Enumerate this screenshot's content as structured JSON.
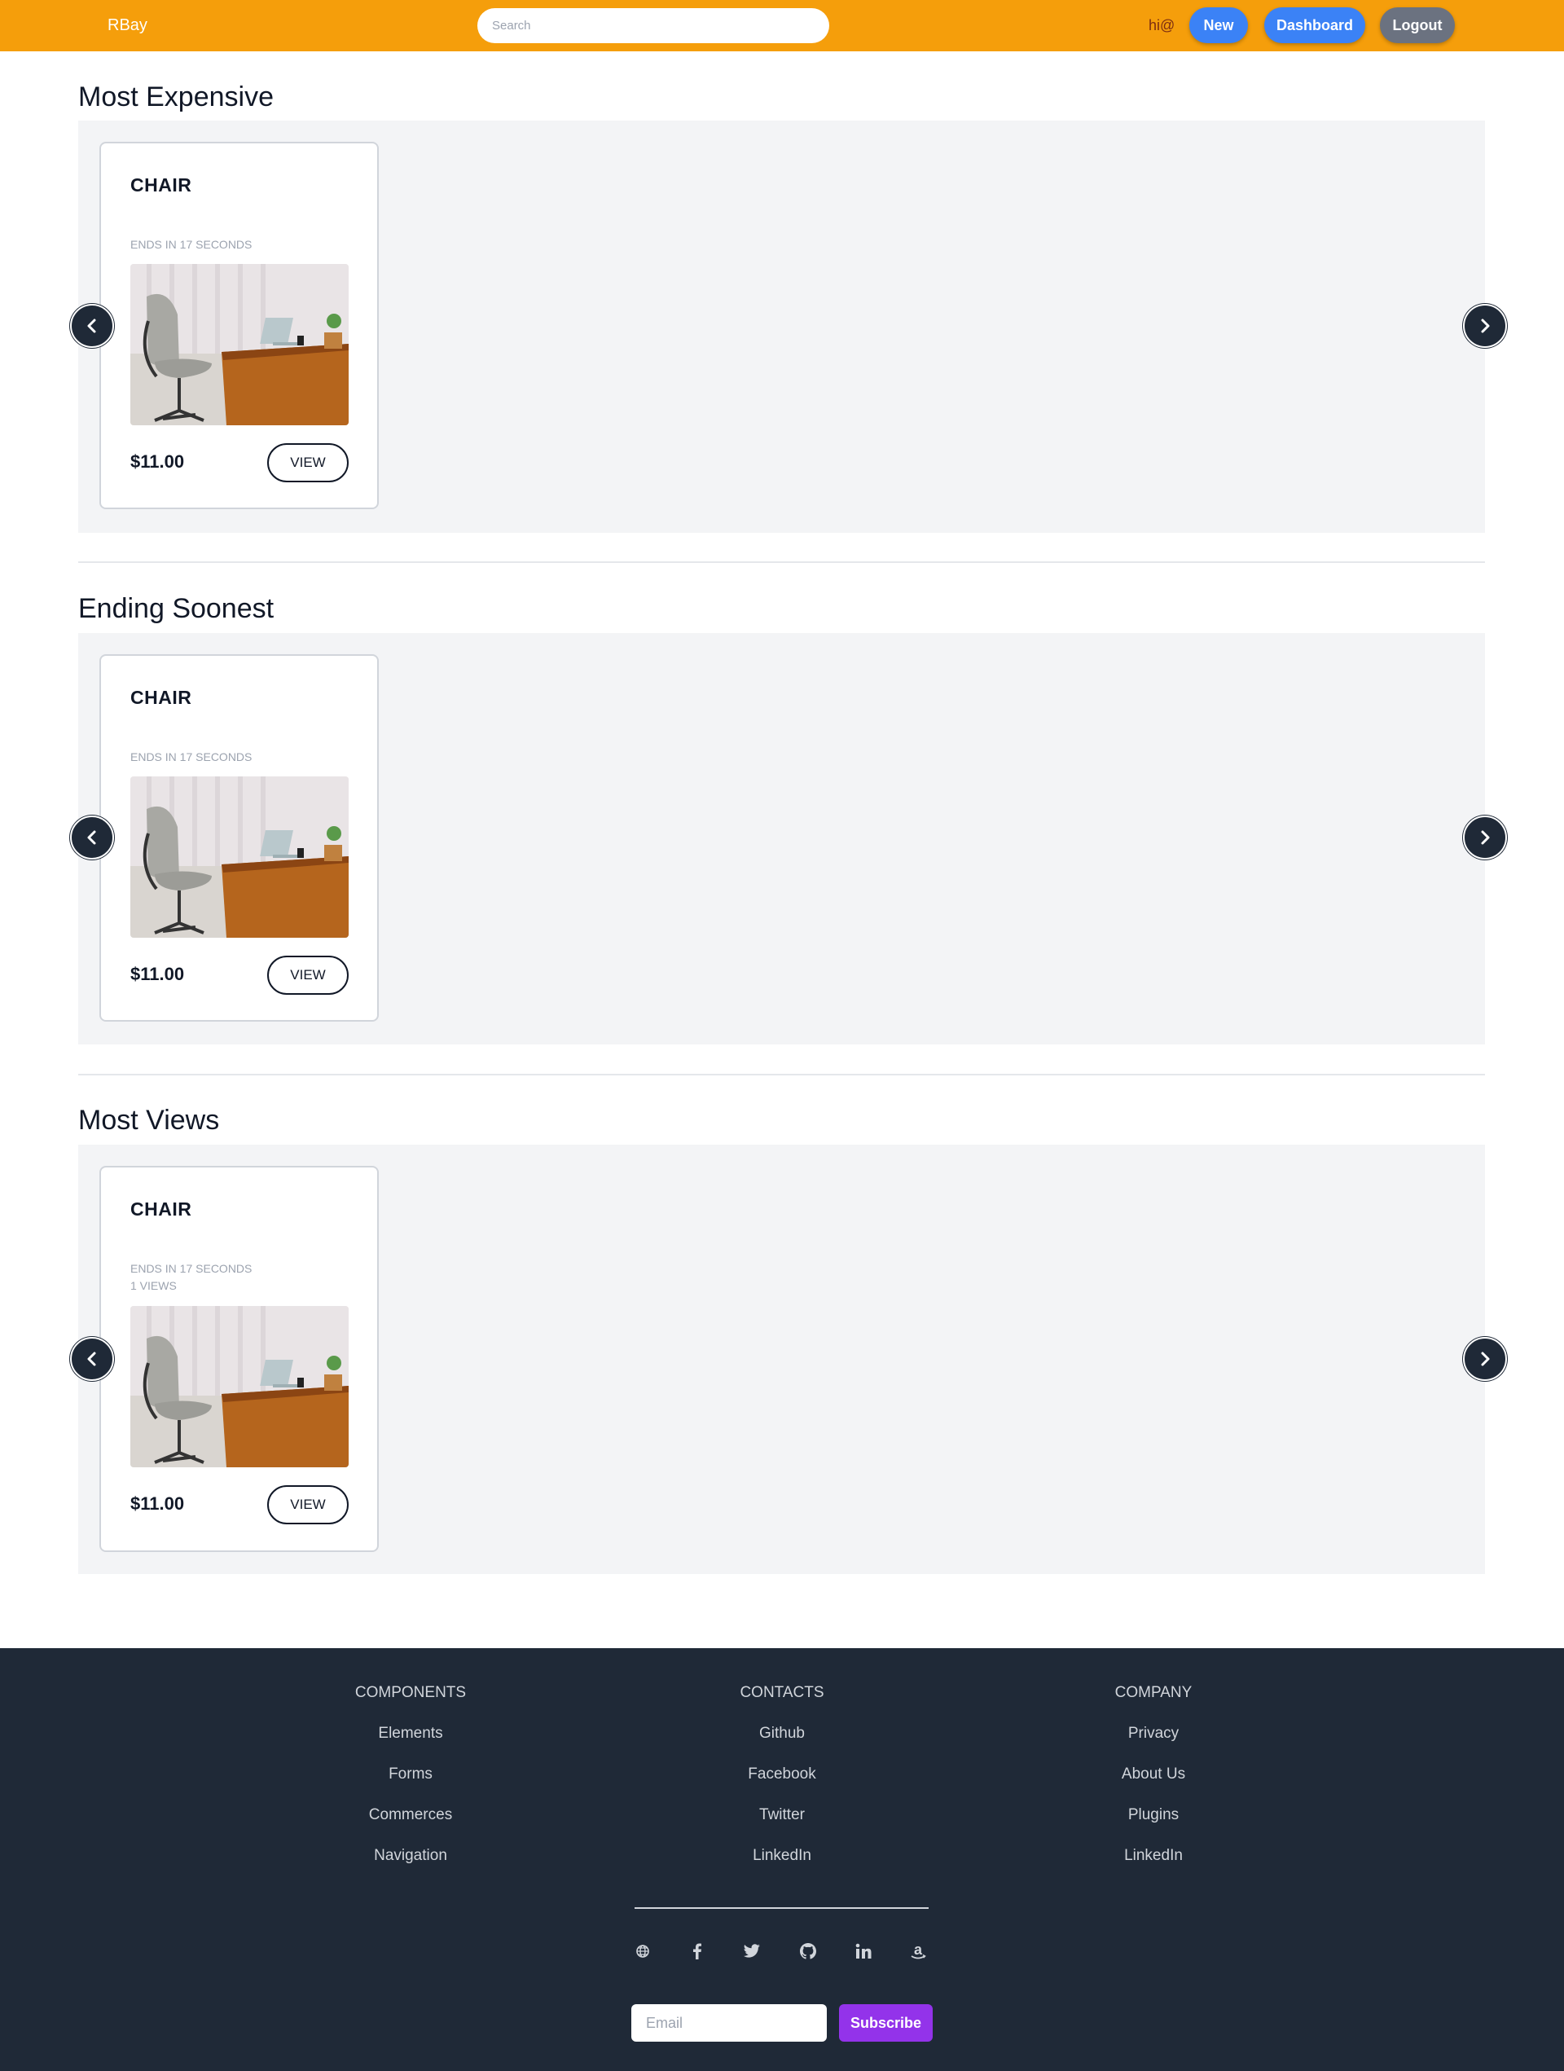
{
  "header": {
    "brand": "RBay",
    "search_placeholder": "Search",
    "greeting": "hi@",
    "new_label": "New",
    "dashboard_label": "Dashboard",
    "logout_label": "Logout"
  },
  "sections": [
    {
      "title": "Most Expensive",
      "card": {
        "title": "CHAIR",
        "meta": [
          "ENDS IN 17 SECONDS"
        ],
        "price": "$11.00",
        "view_label": "VIEW"
      }
    },
    {
      "title": "Ending Soonest",
      "card": {
        "title": "CHAIR",
        "meta": [
          "ENDS IN 17 SECONDS"
        ],
        "price": "$11.00",
        "view_label": "VIEW"
      }
    },
    {
      "title": "Most Views",
      "card": {
        "title": "CHAIR",
        "meta": [
          "ENDS IN 17 SECONDS",
          "1 VIEWS"
        ],
        "price": "$11.00",
        "view_label": "VIEW"
      }
    }
  ],
  "footer": {
    "columns": [
      {
        "heading": "COMPONENTS",
        "links": [
          "Elements",
          "Forms",
          "Commerces",
          "Navigation"
        ]
      },
      {
        "heading": "CONTACTS",
        "links": [
          "Github",
          "Facebook",
          "Twitter",
          "LinkedIn"
        ]
      },
      {
        "heading": "COMPANY",
        "links": [
          "Privacy",
          "About Us",
          "Plugins",
          "LinkedIn"
        ]
      }
    ],
    "social_icons": [
      "globe-icon",
      "facebook-icon",
      "twitter-icon",
      "github-icon",
      "linkedin-icon",
      "amazon-icon"
    ],
    "email_placeholder": "Email",
    "subscribe_label": "Subscribe"
  },
  "colors": {
    "header_bg": "#f59e0b",
    "primary_button": "#3b82f6",
    "logout_button": "#6b7280",
    "footer_bg": "#1f2937",
    "subscribe_button": "#9333ea"
  }
}
